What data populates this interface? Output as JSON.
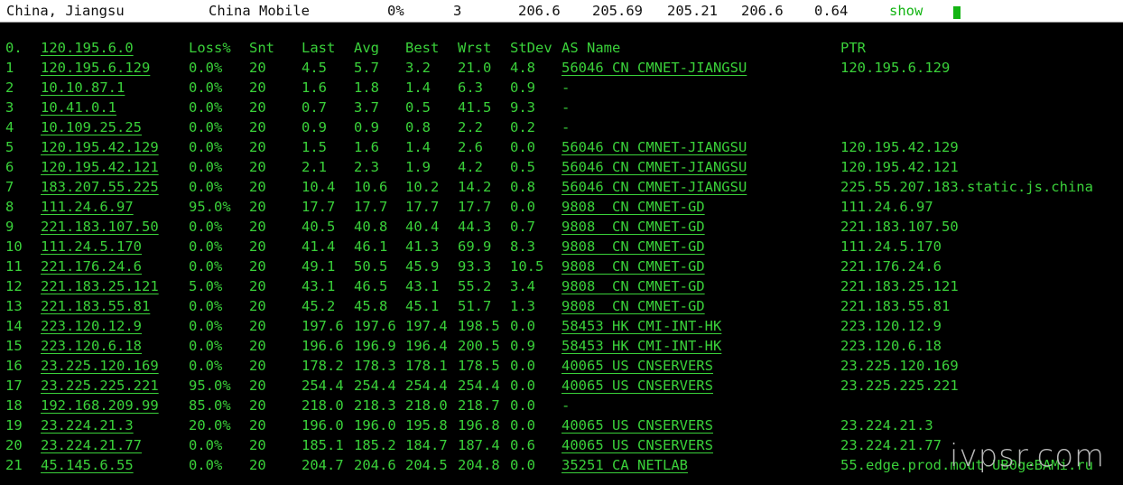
{
  "header": {
    "location": "China, Jiangsu",
    "isp": "China Mobile",
    "loss": "0%",
    "count": "3",
    "v1": "206.6",
    "v2": "205.69",
    "v3": "205.21",
    "v4": "206.6",
    "v5": "0.64",
    "show_label": "show"
  },
  "table": {
    "columns": [
      "0.",
      "120.195.6.0",
      "Loss%",
      "Snt",
      "Last",
      "Avg",
      "Best",
      "Wrst",
      "StDev",
      "AS Name",
      "PTR"
    ],
    "rows": [
      [
        "1",
        "120.195.6.129",
        "0.0%",
        "20",
        "4.5",
        "5.7",
        "3.2",
        "21.0",
        "4.8",
        "56046 CN CMNET-JIANGSU",
        "120.195.6.129"
      ],
      [
        "2",
        "10.10.87.1",
        "0.0%",
        "20",
        "1.6",
        "1.8",
        "1.4",
        "6.3",
        "0.9",
        "-",
        ""
      ],
      [
        "3",
        "10.41.0.1",
        "0.0%",
        "20",
        "0.7",
        "3.7",
        "0.5",
        "41.5",
        "9.3",
        "-",
        ""
      ],
      [
        "4",
        "10.109.25.25",
        "0.0%",
        "20",
        "0.9",
        "0.9",
        "0.8",
        "2.2",
        "0.2",
        "-",
        ""
      ],
      [
        "5",
        "120.195.42.129",
        "0.0%",
        "20",
        "1.5",
        "1.6",
        "1.4",
        "2.6",
        "0.0",
        "56046 CN CMNET-JIANGSU",
        "120.195.42.129"
      ],
      [
        "6",
        "120.195.42.121",
        "0.0%",
        "20",
        "2.1",
        "2.3",
        "1.9",
        "4.2",
        "0.5",
        "56046 CN CMNET-JIANGSU",
        "120.195.42.121"
      ],
      [
        "7",
        "183.207.55.225",
        "0.0%",
        "20",
        "10.4",
        "10.6",
        "10.2",
        "14.2",
        "0.8",
        "56046 CN CMNET-JIANGSU",
        "225.55.207.183.static.js.china"
      ],
      [
        "8",
        "111.24.6.97",
        "95.0%",
        "20",
        "17.7",
        "17.7",
        "17.7",
        "17.7",
        "0.0",
        "9808  CN CMNET-GD",
        "111.24.6.97"
      ],
      [
        "9",
        "221.183.107.50",
        "0.0%",
        "20",
        "40.5",
        "40.8",
        "40.4",
        "44.3",
        "0.7",
        "9808  CN CMNET-GD",
        "221.183.107.50"
      ],
      [
        "10",
        "111.24.5.170",
        "0.0%",
        "20",
        "41.4",
        "46.1",
        "41.3",
        "69.9",
        "8.3",
        "9808  CN CMNET-GD",
        "111.24.5.170"
      ],
      [
        "11",
        "221.176.24.6",
        "0.0%",
        "20",
        "49.1",
        "50.5",
        "45.9",
        "93.3",
        "10.5",
        "9808  CN CMNET-GD",
        "221.176.24.6"
      ],
      [
        "12",
        "221.183.25.121",
        "5.0%",
        "20",
        "43.1",
        "46.5",
        "43.1",
        "55.2",
        "3.4",
        "9808  CN CMNET-GD",
        "221.183.25.121"
      ],
      [
        "13",
        "221.183.55.81",
        "0.0%",
        "20",
        "45.2",
        "45.8",
        "45.1",
        "51.7",
        "1.3",
        "9808  CN CMNET-GD",
        "221.183.55.81"
      ],
      [
        "14",
        "223.120.12.9",
        "0.0%",
        "20",
        "197.6",
        "197.6",
        "197.4",
        "198.5",
        "0.0",
        "58453 HK CMI-INT-HK",
        "223.120.12.9"
      ],
      [
        "15",
        "223.120.6.18",
        "0.0%",
        "20",
        "196.6",
        "196.9",
        "196.4",
        "200.5",
        "0.9",
        "58453 HK CMI-INT-HK",
        "223.120.6.18"
      ],
      [
        "16",
        "23.225.120.169",
        "0.0%",
        "20",
        "178.2",
        "178.3",
        "178.1",
        "178.5",
        "0.0",
        "40065 US CNSERVERS",
        "23.225.120.169"
      ],
      [
        "17",
        "23.225.225.221",
        "95.0%",
        "20",
        "254.4",
        "254.4",
        "254.4",
        "254.4",
        "0.0",
        "40065 US CNSERVERS",
        "23.225.225.221"
      ],
      [
        "18",
        "192.168.209.99",
        "85.0%",
        "20",
        "218.0",
        "218.3",
        "218.0",
        "218.7",
        "0.0",
        "-",
        ""
      ],
      [
        "19",
        "23.224.21.3",
        "20.0%",
        "20",
        "196.0",
        "196.0",
        "195.8",
        "196.8",
        "0.0",
        "40065 US CNSERVERS",
        "23.224.21.3"
      ],
      [
        "20",
        "23.224.21.77",
        "0.0%",
        "20",
        "185.1",
        "185.2",
        "184.7",
        "187.4",
        "0.6",
        "40065 US CNSERVERS",
        "23.224.21.77"
      ],
      [
        "21",
        "45.145.6.55",
        "0.0%",
        "20",
        "204.7",
        "204.6",
        "204.5",
        "204.8",
        "0.0",
        "35251 CA NETLAB",
        "55.edge.prod.mout-UB0geBAMi.ru"
      ]
    ]
  },
  "watermark": "ivpsr.com",
  "colors": {
    "terminal_text": "#3ad13a",
    "terminal_bg": "#000000",
    "header_bg": "#ffffff",
    "show_link": "#13b413"
  }
}
